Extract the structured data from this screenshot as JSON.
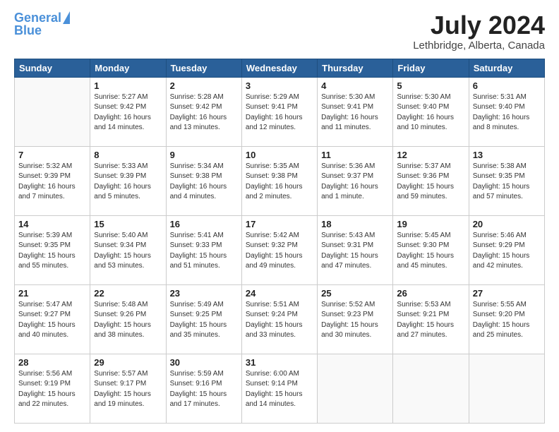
{
  "header": {
    "logo_general": "General",
    "logo_blue": "Blue",
    "month_title": "July 2024",
    "subtitle": "Lethbridge, Alberta, Canada"
  },
  "weekdays": [
    "Sunday",
    "Monday",
    "Tuesday",
    "Wednesday",
    "Thursday",
    "Friday",
    "Saturday"
  ],
  "weeks": [
    [
      {
        "day": "",
        "info": ""
      },
      {
        "day": "1",
        "info": "Sunrise: 5:27 AM\nSunset: 9:42 PM\nDaylight: 16 hours\nand 14 minutes."
      },
      {
        "day": "2",
        "info": "Sunrise: 5:28 AM\nSunset: 9:42 PM\nDaylight: 16 hours\nand 13 minutes."
      },
      {
        "day": "3",
        "info": "Sunrise: 5:29 AM\nSunset: 9:41 PM\nDaylight: 16 hours\nand 12 minutes."
      },
      {
        "day": "4",
        "info": "Sunrise: 5:30 AM\nSunset: 9:41 PM\nDaylight: 16 hours\nand 11 minutes."
      },
      {
        "day": "5",
        "info": "Sunrise: 5:30 AM\nSunset: 9:40 PM\nDaylight: 16 hours\nand 10 minutes."
      },
      {
        "day": "6",
        "info": "Sunrise: 5:31 AM\nSunset: 9:40 PM\nDaylight: 16 hours\nand 8 minutes."
      }
    ],
    [
      {
        "day": "7",
        "info": "Sunrise: 5:32 AM\nSunset: 9:39 PM\nDaylight: 16 hours\nand 7 minutes."
      },
      {
        "day": "8",
        "info": "Sunrise: 5:33 AM\nSunset: 9:39 PM\nDaylight: 16 hours\nand 5 minutes."
      },
      {
        "day": "9",
        "info": "Sunrise: 5:34 AM\nSunset: 9:38 PM\nDaylight: 16 hours\nand 4 minutes."
      },
      {
        "day": "10",
        "info": "Sunrise: 5:35 AM\nSunset: 9:38 PM\nDaylight: 16 hours\nand 2 minutes."
      },
      {
        "day": "11",
        "info": "Sunrise: 5:36 AM\nSunset: 9:37 PM\nDaylight: 16 hours\nand 1 minute."
      },
      {
        "day": "12",
        "info": "Sunrise: 5:37 AM\nSunset: 9:36 PM\nDaylight: 15 hours\nand 59 minutes."
      },
      {
        "day": "13",
        "info": "Sunrise: 5:38 AM\nSunset: 9:35 PM\nDaylight: 15 hours\nand 57 minutes."
      }
    ],
    [
      {
        "day": "14",
        "info": "Sunrise: 5:39 AM\nSunset: 9:35 PM\nDaylight: 15 hours\nand 55 minutes."
      },
      {
        "day": "15",
        "info": "Sunrise: 5:40 AM\nSunset: 9:34 PM\nDaylight: 15 hours\nand 53 minutes."
      },
      {
        "day": "16",
        "info": "Sunrise: 5:41 AM\nSunset: 9:33 PM\nDaylight: 15 hours\nand 51 minutes."
      },
      {
        "day": "17",
        "info": "Sunrise: 5:42 AM\nSunset: 9:32 PM\nDaylight: 15 hours\nand 49 minutes."
      },
      {
        "day": "18",
        "info": "Sunrise: 5:43 AM\nSunset: 9:31 PM\nDaylight: 15 hours\nand 47 minutes."
      },
      {
        "day": "19",
        "info": "Sunrise: 5:45 AM\nSunset: 9:30 PM\nDaylight: 15 hours\nand 45 minutes."
      },
      {
        "day": "20",
        "info": "Sunrise: 5:46 AM\nSunset: 9:29 PM\nDaylight: 15 hours\nand 42 minutes."
      }
    ],
    [
      {
        "day": "21",
        "info": "Sunrise: 5:47 AM\nSunset: 9:27 PM\nDaylight: 15 hours\nand 40 minutes."
      },
      {
        "day": "22",
        "info": "Sunrise: 5:48 AM\nSunset: 9:26 PM\nDaylight: 15 hours\nand 38 minutes."
      },
      {
        "day": "23",
        "info": "Sunrise: 5:49 AM\nSunset: 9:25 PM\nDaylight: 15 hours\nand 35 minutes."
      },
      {
        "day": "24",
        "info": "Sunrise: 5:51 AM\nSunset: 9:24 PM\nDaylight: 15 hours\nand 33 minutes."
      },
      {
        "day": "25",
        "info": "Sunrise: 5:52 AM\nSunset: 9:23 PM\nDaylight: 15 hours\nand 30 minutes."
      },
      {
        "day": "26",
        "info": "Sunrise: 5:53 AM\nSunset: 9:21 PM\nDaylight: 15 hours\nand 27 minutes."
      },
      {
        "day": "27",
        "info": "Sunrise: 5:55 AM\nSunset: 9:20 PM\nDaylight: 15 hours\nand 25 minutes."
      }
    ],
    [
      {
        "day": "28",
        "info": "Sunrise: 5:56 AM\nSunset: 9:19 PM\nDaylight: 15 hours\nand 22 minutes."
      },
      {
        "day": "29",
        "info": "Sunrise: 5:57 AM\nSunset: 9:17 PM\nDaylight: 15 hours\nand 19 minutes."
      },
      {
        "day": "30",
        "info": "Sunrise: 5:59 AM\nSunset: 9:16 PM\nDaylight: 15 hours\nand 17 minutes."
      },
      {
        "day": "31",
        "info": "Sunrise: 6:00 AM\nSunset: 9:14 PM\nDaylight: 15 hours\nand 14 minutes."
      },
      {
        "day": "",
        "info": ""
      },
      {
        "day": "",
        "info": ""
      },
      {
        "day": "",
        "info": ""
      }
    ]
  ]
}
